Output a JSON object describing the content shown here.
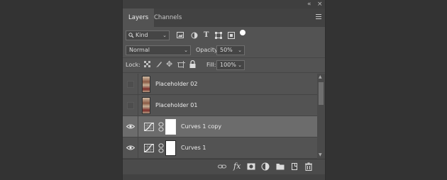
{
  "panel": {
    "tabs": [
      {
        "label": "Layers",
        "active": true
      },
      {
        "label": "Channels",
        "active": false
      }
    ],
    "titlebar_icons": [
      "collapse-icon",
      "close-icon"
    ]
  },
  "filter": {
    "label": "Kind",
    "icons": [
      "pixel-filter-icon",
      "adjustment-filter-icon",
      "type-filter-icon",
      "shape-filter-icon",
      "smart-object-filter-icon",
      "filter-toggle-icon"
    ]
  },
  "blend": {
    "mode": "Normal",
    "opacity_label": "Opacity:",
    "opacity_value": "50%"
  },
  "lock": {
    "label": "Lock:",
    "icons": [
      "lock-transparent-pixels-icon",
      "lock-image-pixels-icon",
      "lock-position-icon",
      "lock-artboard-icon",
      "lock-all-icon"
    ],
    "fill_label": "Fill:",
    "fill_value": "100%"
  },
  "layers": [
    {
      "name": "Placeholder 02",
      "type": "image",
      "visible": false,
      "selected": false
    },
    {
      "name": "Placeholder 01",
      "type": "image",
      "visible": false,
      "selected": false
    },
    {
      "name": "Curves 1 copy",
      "type": "curves",
      "visible": true,
      "selected": true
    },
    {
      "name": "Curves 1",
      "type": "curves",
      "visible": true,
      "selected": false
    }
  ],
  "footer_icons": [
    "link-layers-icon",
    "layer-style-icon",
    "add-mask-icon",
    "new-adjustment-icon",
    "new-group-icon",
    "new-layer-icon",
    "delete-layer-icon"
  ],
  "colors": {
    "panel_bg": "#535353",
    "selected_row": "#6c6c6c",
    "app_bg": "#333333"
  }
}
